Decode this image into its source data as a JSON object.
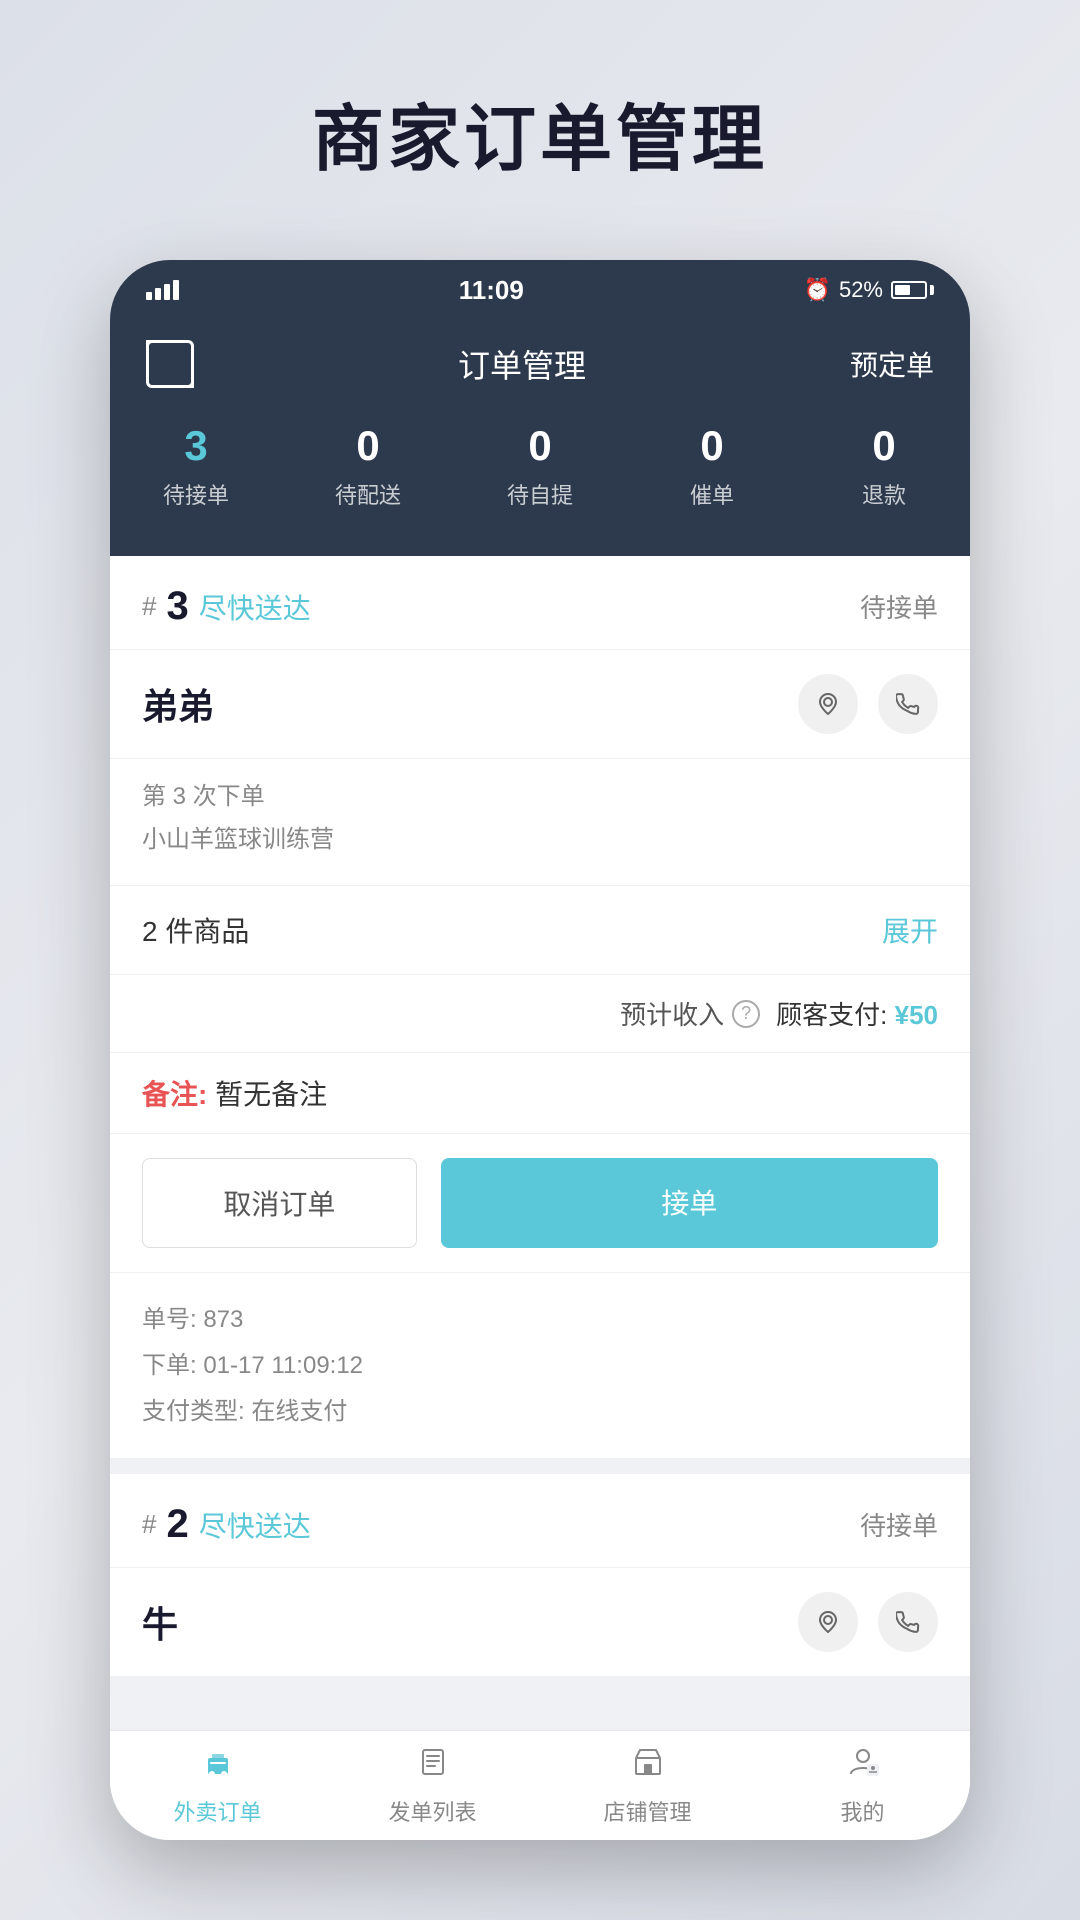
{
  "page": {
    "title": "商家订单管理"
  },
  "statusBar": {
    "time": "11:09",
    "battery": "52%",
    "alarmIcon": "⏰"
  },
  "header": {
    "title": "订单管理",
    "rightLabel": "预定单",
    "scanLabel": "扫码"
  },
  "stats": [
    {
      "number": "3",
      "label": "待接单",
      "highlighted": true
    },
    {
      "number": "0",
      "label": "待配送",
      "highlighted": false
    },
    {
      "number": "0",
      "label": "待自提",
      "highlighted": false
    },
    {
      "number": "0",
      "label": "催单",
      "highlighted": false
    },
    {
      "number": "0",
      "label": "退款",
      "highlighted": false
    }
  ],
  "orders": [
    {
      "id": "order-1",
      "number": "3",
      "deliveryType": "尽快送达",
      "status": "待接单",
      "customerName": "弟弟",
      "orderCount": "第 3 次下单",
      "address": "小山羊篮球训练营",
      "itemsCount": "2 件商品",
      "expandLabel": "展开",
      "estimatedIncome": "预计收入",
      "helpIcon": "?",
      "customerPayLabel": "顾客支付:",
      "customerPayAmount": "¥50",
      "noteLabel": "备注:",
      "noteContent": "暂无备注",
      "cancelLabel": "取消订单",
      "acceptLabel": "接单",
      "orderNo": "单号: 873",
      "orderTime": "下单: 01-17 11:09:12",
      "payType": "支付类型: 在线支付"
    },
    {
      "id": "order-2",
      "number": "2",
      "deliveryType": "尽快送达",
      "status": "待接单",
      "customerName": "牛",
      "orderCount": "",
      "address": ""
    }
  ],
  "bottomNav": [
    {
      "id": "takeout",
      "label": "外卖订单",
      "active": true,
      "icon": "🥤"
    },
    {
      "id": "orders",
      "label": "发单列表",
      "active": false,
      "icon": "📋"
    },
    {
      "id": "store",
      "label": "店铺管理",
      "active": false,
      "icon": "🏪"
    },
    {
      "id": "mine",
      "label": "我的",
      "active": false,
      "icon": "👤"
    }
  ]
}
